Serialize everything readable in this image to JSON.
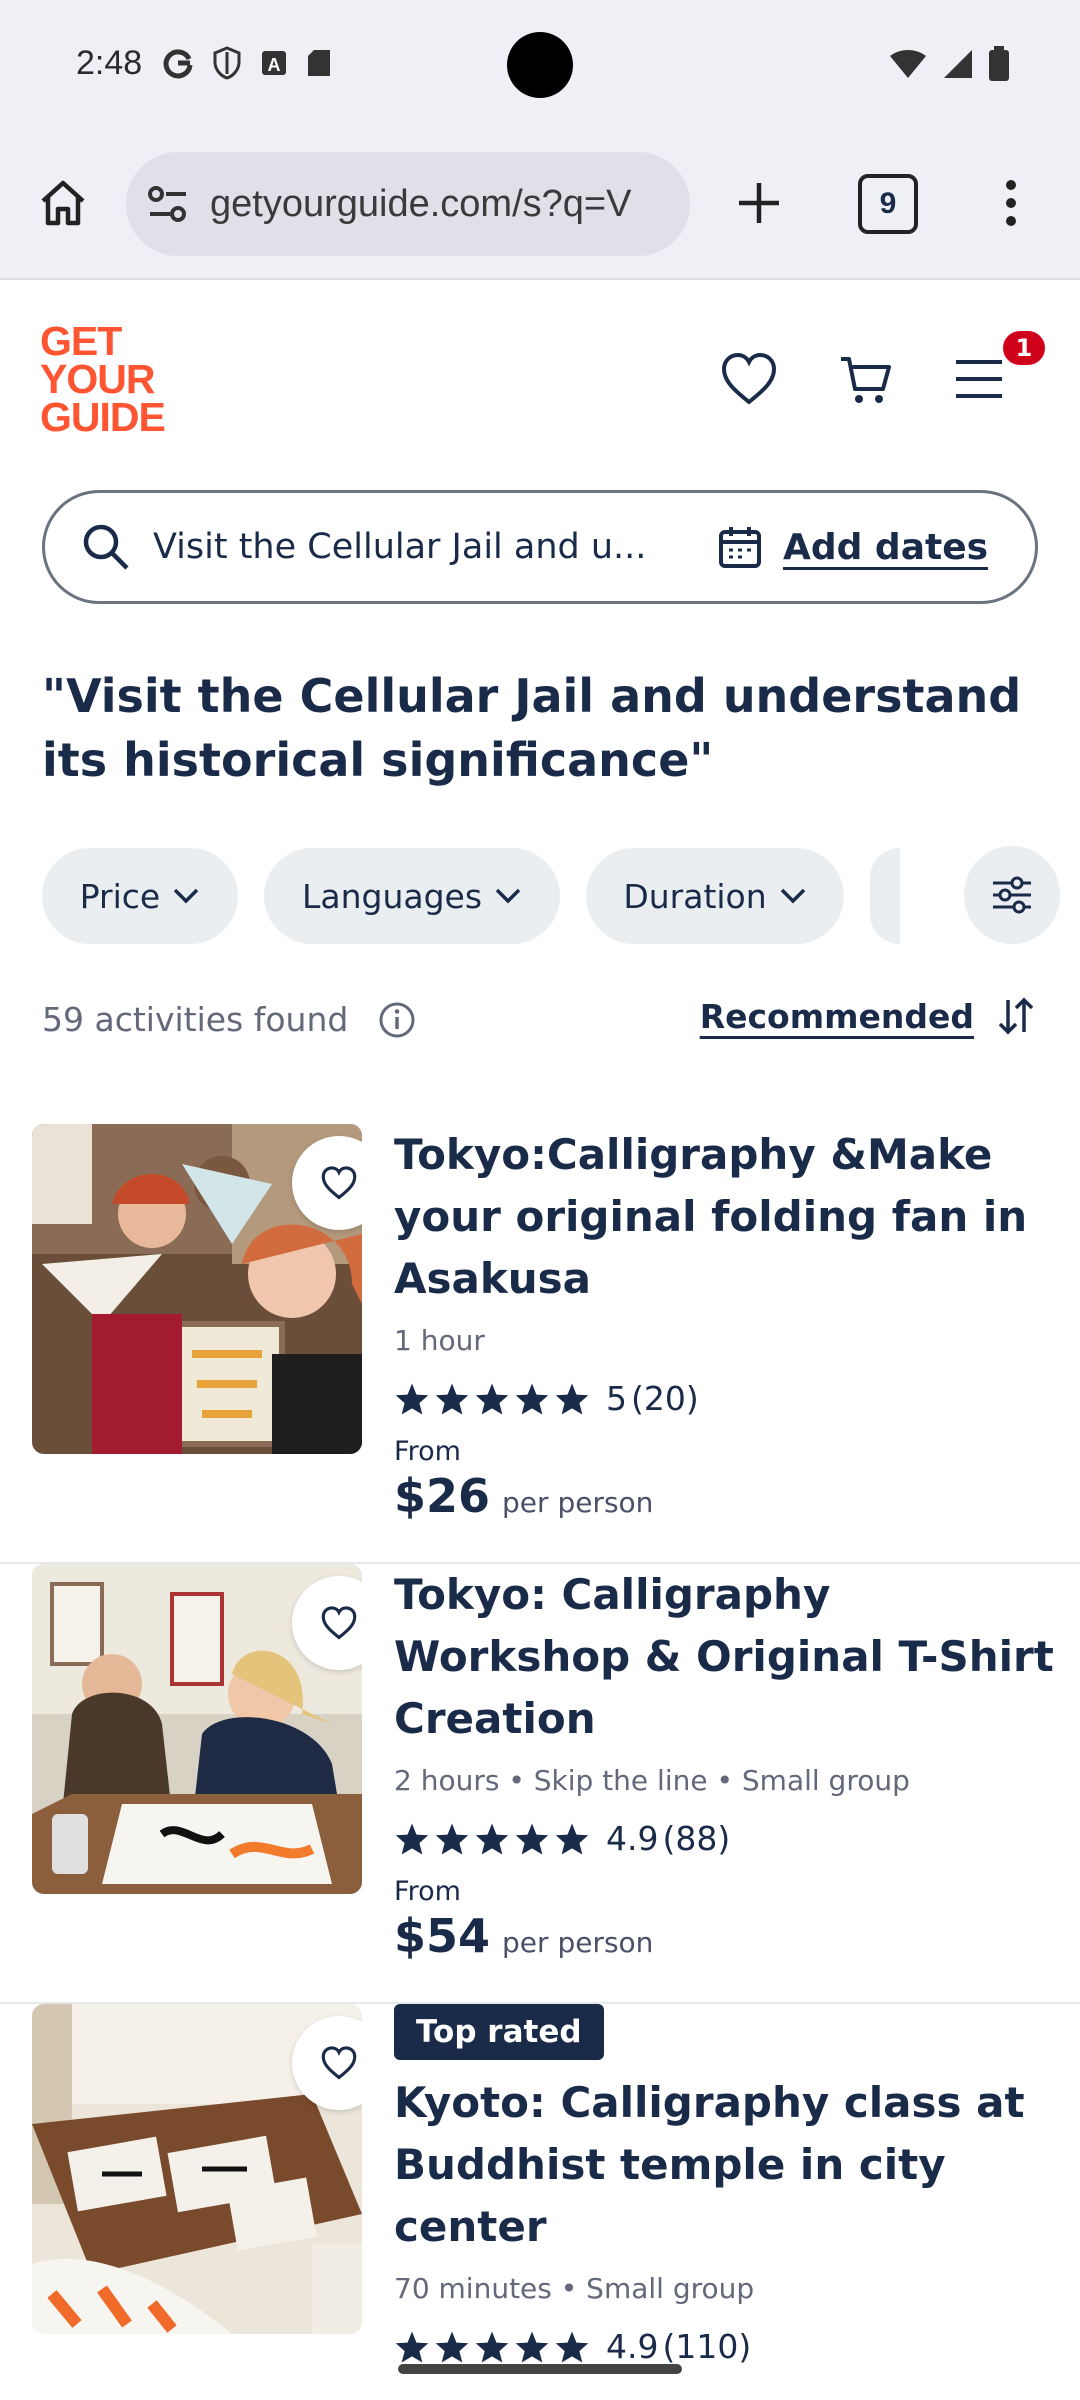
{
  "status_bar": {
    "time": "2:48"
  },
  "browser": {
    "url": "getyourguide.com/s?q=V",
    "tab_count": "9"
  },
  "site": {
    "logo_line1": "GET",
    "logo_line2": "YOUR",
    "logo_line3": "GUIDE",
    "menu_badge": "1"
  },
  "search": {
    "query": "Visit the Cellular Jail and u...",
    "dates_label": "Add dates"
  },
  "heading": "\"Visit the Cellular Jail and understand its historical significance\"",
  "filters": [
    "Price",
    "Languages",
    "Duration"
  ],
  "results": {
    "count_text": "59 activities found",
    "sort_label": "Recommended"
  },
  "cards": [
    {
      "tag": "",
      "title": "Tokyo:Calligraphy &Make your original folding fan in Asakusa",
      "meta": "1 hour",
      "rating": "5",
      "reviews": "(20)",
      "from_label": "From",
      "price": "$26",
      "per": "per person"
    },
    {
      "tag": "",
      "title": "Tokyo: Calligraphy Workshop & Original T-Shirt Creation",
      "meta": "2 hours • Skip the line • Small group",
      "rating": "4.9",
      "reviews": "(88)",
      "from_label": "From",
      "price": "$54",
      "per": "per person"
    },
    {
      "tag": "Top rated",
      "title": "Kyoto: Calligraphy class at Buddhist temple in city center",
      "meta": "70 minutes • Small group",
      "rating": "4.9",
      "reviews": "(110)"
    }
  ],
  "colors": {
    "brand": "#ff5533",
    "navy": "#1a2b49",
    "badge": "#d0021b"
  }
}
